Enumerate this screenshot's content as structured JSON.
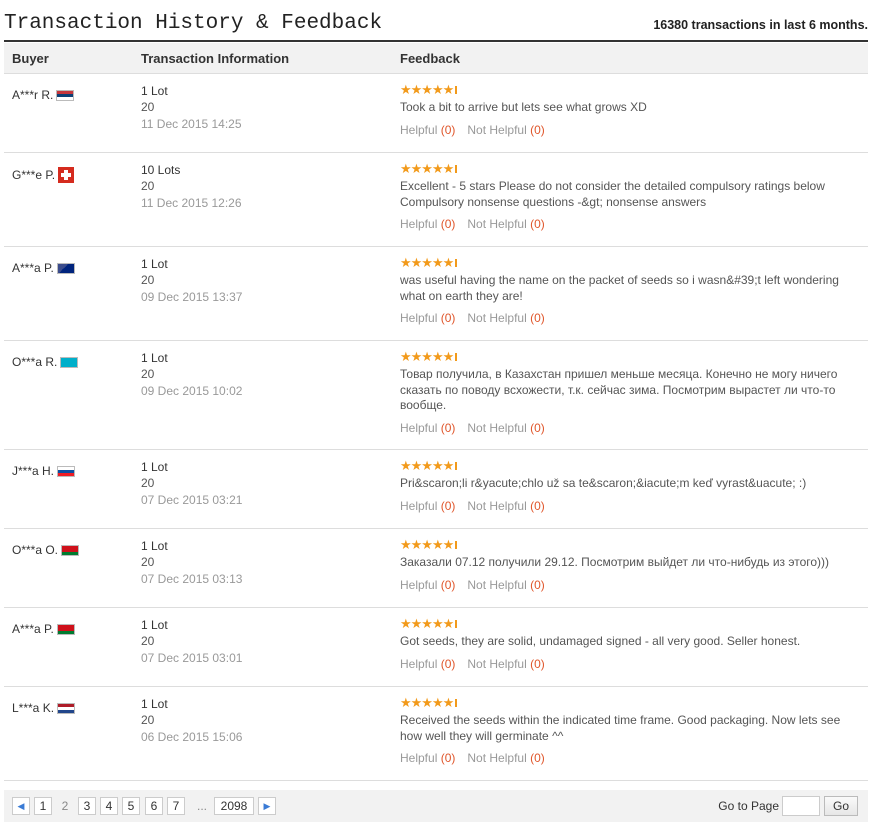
{
  "header": {
    "title": "Transaction History & Feedback",
    "count": "16380 transactions in last 6 months."
  },
  "columns": {
    "buyer": "Buyer",
    "info": "Transaction Information",
    "feedback": "Feedback"
  },
  "helpful_label": "Helpful",
  "not_helpful_label": "Not Helpful",
  "rating_max": 5,
  "rows": [
    {
      "buyer": "A***r R.",
      "flag": "Serbia",
      "lots": "1 Lot",
      "qty": "20",
      "date": "11 Dec 2015 14:25",
      "rating": 5,
      "comment": "Took a bit to arrive but lets see what grows XD",
      "helpful": "(0)",
      "not_helpful": "(0)"
    },
    {
      "buyer": "G***e P.",
      "flag": "Switzerland",
      "lots": "10 Lots",
      "qty": "20",
      "date": "11 Dec 2015 12:26",
      "rating": 5,
      "comment": "Excellent - 5 stars Please do not consider the detailed compulsory ratings below Compulsory nonsense questions -&gt; nonsense answers",
      "helpful": "(0)",
      "not_helpful": "(0)"
    },
    {
      "buyer": "A***a P.",
      "flag": "New Zealand",
      "lots": "1 Lot",
      "qty": "20",
      "date": "09 Dec 2015 13:37",
      "rating": 5,
      "comment": "was useful having the name on the packet of seeds so i wasn&#39;t left wondering what on earth they are!",
      "helpful": "(0)",
      "not_helpful": "(0)"
    },
    {
      "buyer": "O***a R.",
      "flag": "Kazakhstan",
      "lots": "1 Lot",
      "qty": "20",
      "date": "09 Dec 2015 10:02",
      "rating": 5,
      "comment": "Товар получила, в Казахстан пришел меньше месяца. Конечно не могу ничего сказать по поводу всхожести, т.к. сейчас зима. Посмотрим вырастет ли что-то вообще.",
      "helpful": "(0)",
      "not_helpful": "(0)"
    },
    {
      "buyer": "J***a H.",
      "flag": "Slovakia",
      "lots": "1 Lot",
      "qty": "20",
      "date": "07 Dec 2015 03:21",
      "rating": 5,
      "comment": "Pri&scaron;li r&yacute;chlo už sa te&scaron;&iacute;m keď vyrast&uacute; :)",
      "helpful": "(0)",
      "not_helpful": "(0)"
    },
    {
      "buyer": "O***a O.",
      "flag": "Belarus",
      "lots": "1 Lot",
      "qty": "20",
      "date": "07 Dec 2015 03:13",
      "rating": 5,
      "comment": "Заказали 07.12 получили 29.12. Посмотрим выйдет ли что-нибудь из этого)))",
      "helpful": "(0)",
      "not_helpful": "(0)"
    },
    {
      "buyer": "A***a P.",
      "flag": "Belarus",
      "lots": "1 Lot",
      "qty": "20",
      "date": "07 Dec 2015 03:01",
      "rating": 5,
      "comment": "Got seeds, they are solid, undamaged signed - all very good. Seller honest.",
      "helpful": "(0)",
      "not_helpful": "(0)"
    },
    {
      "buyer": "L***a K.",
      "flag": "Netherlands",
      "lots": "1 Lot",
      "qty": "20",
      "date": "06 Dec 2015 15:06",
      "rating": 5,
      "comment": "Received the seeds within the indicated time frame. Good packaging. Now lets see how well they will germinate ^^",
      "helpful": "(0)",
      "not_helpful": "(0)"
    }
  ],
  "pagination": {
    "prev": "◀",
    "next": "▶",
    "pages": [
      "1",
      "2",
      "3",
      "4",
      "5",
      "6",
      "7"
    ],
    "current": "2",
    "ellipsis": "...",
    "last": "2098",
    "goto_label": "Go to Page",
    "goto_button": "Go"
  }
}
